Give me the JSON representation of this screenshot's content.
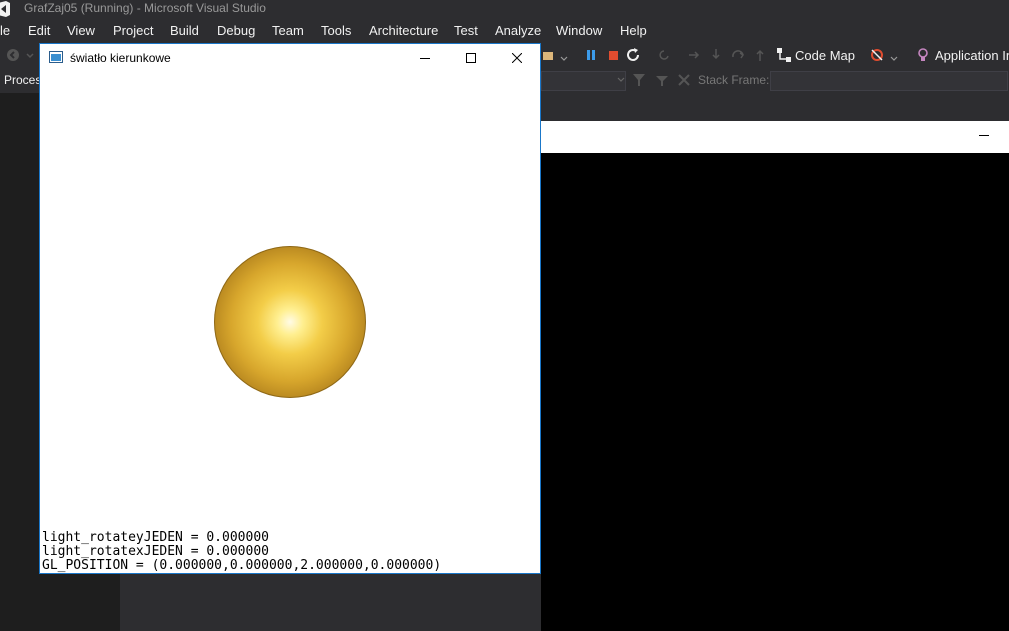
{
  "vs": {
    "title": "GrafZaj05 (Running) - Microsoft Visual Studio",
    "menu": [
      {
        "label": "le",
        "name": "menu-file"
      },
      {
        "label": "Edit",
        "name": "menu-edit"
      },
      {
        "label": "View",
        "name": "menu-view"
      },
      {
        "label": "Project",
        "name": "menu-project"
      },
      {
        "label": "Build",
        "name": "menu-build"
      },
      {
        "label": "Debug",
        "name": "menu-debug"
      },
      {
        "label": "Team",
        "name": "menu-team"
      },
      {
        "label": "Tools",
        "name": "menu-tools"
      },
      {
        "label": "Architecture",
        "name": "menu-architecture"
      },
      {
        "label": "Test",
        "name": "menu-test"
      },
      {
        "label": "Analyze",
        "name": "menu-analyze"
      },
      {
        "label": "Window",
        "name": "menu-window"
      },
      {
        "label": "Help",
        "name": "menu-help"
      }
    ],
    "toolbar": {
      "code_map_label": "Code Map",
      "app_insights_label": "Application In"
    },
    "debugbar": {
      "process_label": "Proces",
      "stack_frame_label": "Stack Frame:"
    },
    "colors": {
      "background": "#2d2d30",
      "accent_blue": "#1a77c9",
      "stop_red": "#e04c2f",
      "pause_blue": "#3c9bea"
    }
  },
  "gl_window": {
    "title": "światło kierunkowe",
    "lines": [
      "light_rotateyJEDEN = 0.000000",
      "light_rotatexJEDEN = 0.000000",
      "GL_POSITION = (0.000000,0.000000,2.000000,0.000000)"
    ],
    "sphere_color": "#d7a62c"
  }
}
